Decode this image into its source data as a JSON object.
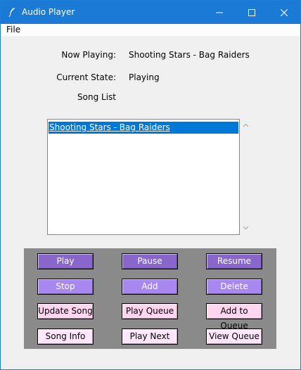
{
  "window": {
    "title": "Audio Player",
    "minimize_glyph": "—",
    "maximize_glyph": "☐",
    "close_glyph": "✕",
    "title_icon": "feather-icon"
  },
  "menubar": {
    "items": [
      {
        "label": "File"
      }
    ]
  },
  "info": {
    "now_playing_label": "Now Playing:",
    "now_playing_value": "Shooting Stars - Bag Raiders",
    "current_state_label": "Current State:",
    "current_state_value": "Playing",
    "song_list_label": "Song List"
  },
  "song_list": {
    "items": [
      {
        "title": "Shooting Stars - Bag Raiders",
        "selected": true
      }
    ],
    "scroll_up_icon": "chevron-up-icon",
    "scroll_down_icon": "chevron-down-icon"
  },
  "buttons": {
    "row1": [
      "Play",
      "Pause",
      "Resume"
    ],
    "row2": [
      "Stop",
      "Add",
      "Delete"
    ],
    "row3": [
      "Update Song",
      "Play Queue",
      "Add to Queue"
    ],
    "row4": [
      "Song Info",
      "Play Next",
      "View Queue"
    ]
  },
  "colors": {
    "titlebar": "#1a7ad6",
    "selection": "#0078d7",
    "panel": "#8a8a8a",
    "button_dark": "#8866cc",
    "button_mid": "#a888f0",
    "button_pink": "#ffd6f0",
    "button_light_pink": "#ffe6fa"
  }
}
